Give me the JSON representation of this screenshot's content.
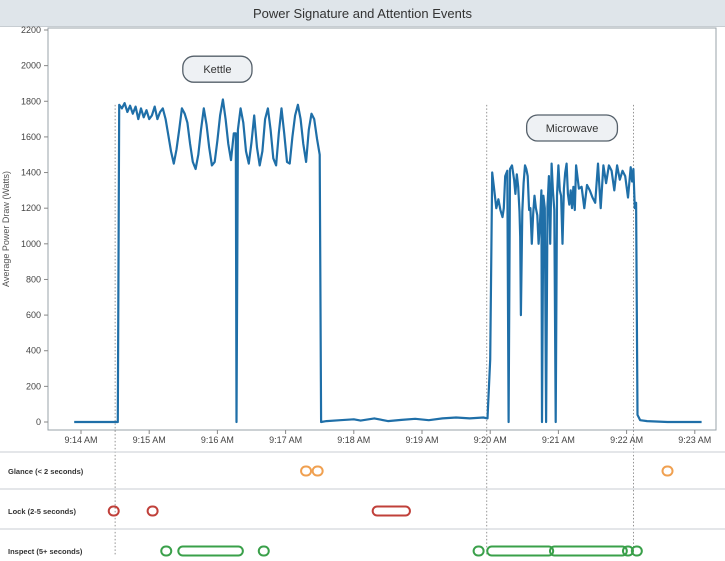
{
  "chart_data": {
    "type": "line",
    "title": "Power Signature and Attention Events",
    "ylabel": "Average Power Draw (Watts)",
    "xlabel": "",
    "ylim": [
      0,
      2200
    ],
    "y_ticks": [
      0,
      200,
      400,
      600,
      800,
      1000,
      1200,
      1400,
      1600,
      1800,
      2000,
      2200
    ],
    "x_ticks": [
      {
        "t": 0,
        "label": "9:14 AM"
      },
      {
        "t": 1,
        "label": "9:15 AM"
      },
      {
        "t": 2,
        "label": "9:16 AM"
      },
      {
        "t": 3,
        "label": "9:17 AM"
      },
      {
        "t": 4,
        "label": "9:18 AM"
      },
      {
        "t": 5,
        "label": "9:19 AM"
      },
      {
        "t": 6,
        "label": "9:20 AM"
      },
      {
        "t": 7,
        "label": "9:21 AM"
      },
      {
        "t": 8,
        "label": "9:22 AM"
      },
      {
        "t": 9,
        "label": "9:23 AM"
      }
    ],
    "x_unit": "minutes after 9:14 AM",
    "grid": false,
    "series": [
      {
        "name": "",
        "color": "#1f6fa8",
        "points": [
          [
            -0.1,
            0
          ],
          [
            0.5,
            0
          ],
          [
            0.54,
            0
          ],
          [
            0.56,
            1780
          ],
          [
            0.6,
            1760
          ],
          [
            0.64,
            1790
          ],
          [
            0.68,
            1740
          ],
          [
            0.72,
            1775
          ],
          [
            0.76,
            1730
          ],
          [
            0.8,
            1770
          ],
          [
            0.84,
            1700
          ],
          [
            0.88,
            1760
          ],
          [
            0.92,
            1710
          ],
          [
            0.96,
            1750
          ],
          [
            1.0,
            1700
          ],
          [
            1.04,
            1720
          ],
          [
            1.08,
            1770
          ],
          [
            1.12,
            1700
          ],
          [
            1.16,
            1740
          ],
          [
            1.2,
            1760
          ],
          [
            1.24,
            1700
          ],
          [
            1.28,
            1610
          ],
          [
            1.32,
            1520
          ],
          [
            1.36,
            1450
          ],
          [
            1.4,
            1530
          ],
          [
            1.44,
            1640
          ],
          [
            1.48,
            1760
          ],
          [
            1.52,
            1730
          ],
          [
            1.56,
            1680
          ],
          [
            1.6,
            1560
          ],
          [
            1.64,
            1460
          ],
          [
            1.68,
            1420
          ],
          [
            1.72,
            1500
          ],
          [
            1.76,
            1640
          ],
          [
            1.8,
            1760
          ],
          [
            1.84,
            1670
          ],
          [
            1.88,
            1540
          ],
          [
            1.92,
            1440
          ],
          [
            1.96,
            1460
          ],
          [
            2.0,
            1580
          ],
          [
            2.04,
            1720
          ],
          [
            2.08,
            1810
          ],
          [
            2.12,
            1700
          ],
          [
            2.16,
            1560
          ],
          [
            2.2,
            1470
          ],
          [
            2.24,
            1620
          ],
          [
            2.27,
            1620
          ],
          [
            2.28,
            0
          ],
          [
            2.3,
            1640
          ],
          [
            2.34,
            1760
          ],
          [
            2.38,
            1680
          ],
          [
            2.42,
            1520
          ],
          [
            2.46,
            1450
          ],
          [
            2.5,
            1570
          ],
          [
            2.54,
            1720
          ],
          [
            2.58,
            1540
          ],
          [
            2.62,
            1440
          ],
          [
            2.66,
            1520
          ],
          [
            2.7,
            1700
          ],
          [
            2.74,
            1760
          ],
          [
            2.78,
            1640
          ],
          [
            2.82,
            1480
          ],
          [
            2.86,
            1440
          ],
          [
            2.9,
            1620
          ],
          [
            2.94,
            1760
          ],
          [
            2.98,
            1620
          ],
          [
            3.02,
            1460
          ],
          [
            3.06,
            1450
          ],
          [
            3.1,
            1600
          ],
          [
            3.14,
            1720
          ],
          [
            3.18,
            1780
          ],
          [
            3.22,
            1700
          ],
          [
            3.26,
            1560
          ],
          [
            3.3,
            1460
          ],
          [
            3.34,
            1640
          ],
          [
            3.38,
            1730
          ],
          [
            3.42,
            1700
          ],
          [
            3.46,
            1590
          ],
          [
            3.5,
            1500
          ],
          [
            3.52,
            0
          ],
          [
            3.6,
            5
          ],
          [
            3.8,
            10
          ],
          [
            4.0,
            15
          ],
          [
            4.1,
            8
          ],
          [
            4.3,
            20
          ],
          [
            4.5,
            5
          ],
          [
            4.7,
            12
          ],
          [
            4.9,
            18
          ],
          [
            5.1,
            10
          ],
          [
            5.3,
            20
          ],
          [
            5.5,
            25
          ],
          [
            5.7,
            20
          ],
          [
            5.9,
            25
          ],
          [
            5.96,
            20
          ],
          [
            6.0,
            350
          ],
          [
            6.03,
            1400
          ],
          [
            6.06,
            1300
          ],
          [
            6.09,
            1200
          ],
          [
            6.12,
            1250
          ],
          [
            6.15,
            1190
          ],
          [
            6.18,
            1150
          ],
          [
            6.2,
            1200
          ],
          [
            6.22,
            1380
          ],
          [
            6.25,
            1410
          ],
          [
            6.27,
            0
          ],
          [
            6.29,
            1420
          ],
          [
            6.32,
            1440
          ],
          [
            6.35,
            1360
          ],
          [
            6.37,
            1280
          ],
          [
            6.39,
            1390
          ],
          [
            6.41,
            1320
          ],
          [
            6.43,
            1180
          ],
          [
            6.44,
            1040
          ],
          [
            6.45,
            600
          ],
          [
            6.47,
            1180
          ],
          [
            6.49,
            1340
          ],
          [
            6.51,
            1440
          ],
          [
            6.53,
            1420
          ],
          [
            6.55,
            1380
          ],
          [
            6.57,
            1190
          ],
          [
            6.59,
            1200
          ],
          [
            6.61,
            1000
          ],
          [
            6.63,
            1170
          ],
          [
            6.65,
            1270
          ],
          [
            6.67,
            1200
          ],
          [
            6.69,
            1160
          ],
          [
            6.71,
            1000
          ],
          [
            6.73,
            1120
          ],
          [
            6.75,
            1300
          ],
          [
            6.76,
            0
          ],
          [
            6.78,
            1270
          ],
          [
            6.8,
            1200
          ],
          [
            6.82,
            0
          ],
          [
            6.84,
            1210
          ],
          [
            6.86,
            1380
          ],
          [
            6.88,
            1000
          ],
          [
            6.9,
            1450
          ],
          [
            6.92,
            1300
          ],
          [
            6.94,
            1190
          ],
          [
            6.96,
            0
          ],
          [
            6.98,
            1270
          ],
          [
            7.0,
            1440
          ],
          [
            7.02,
            1300
          ],
          [
            7.04,
            1270
          ],
          [
            7.06,
            1000
          ],
          [
            7.08,
            1310
          ],
          [
            7.1,
            1400
          ],
          [
            7.12,
            1450
          ],
          [
            7.14,
            1280
          ],
          [
            7.16,
            1220
          ],
          [
            7.18,
            1300
          ],
          [
            7.2,
            1200
          ],
          [
            7.22,
            1320
          ],
          [
            7.24,
            1190
          ],
          [
            7.26,
            1440
          ],
          [
            7.3,
            1310
          ],
          [
            7.34,
            1320
          ],
          [
            7.38,
            1200
          ],
          [
            7.42,
            1330
          ],
          [
            7.46,
            1300
          ],
          [
            7.5,
            1260
          ],
          [
            7.54,
            1230
          ],
          [
            7.58,
            1450
          ],
          [
            7.62,
            1200
          ],
          [
            7.66,
            1440
          ],
          [
            7.7,
            1340
          ],
          [
            7.74,
            1440
          ],
          [
            7.78,
            1410
          ],
          [
            7.82,
            1300
          ],
          [
            7.86,
            1440
          ],
          [
            7.9,
            1360
          ],
          [
            7.94,
            1410
          ],
          [
            7.98,
            1380
          ],
          [
            8.02,
            1260
          ],
          [
            8.06,
            1430
          ],
          [
            8.08,
            1350
          ],
          [
            8.1,
            1420
          ],
          [
            8.12,
            1200
          ],
          [
            8.14,
            1230
          ],
          [
            8.16,
            40
          ],
          [
            8.2,
            10
          ],
          [
            8.3,
            5
          ],
          [
            8.6,
            0
          ],
          [
            9.0,
            0
          ],
          [
            9.1,
            0
          ]
        ]
      }
    ],
    "annotations": [
      {
        "text": "Kettle",
        "t": 2.0,
        "y": 1980
      },
      {
        "text": "Microwave",
        "t": 7.2,
        "y": 1650
      }
    ],
    "event_lanes": [
      {
        "label": "Glance (< 2 seconds)",
        "color": "#f0a050",
        "events": [
          {
            "start": 3.3,
            "end": 3.3
          },
          {
            "start": 3.47,
            "end": 3.47
          },
          {
            "start": 8.6,
            "end": 8.6
          }
        ]
      },
      {
        "label": "Lock (2-5 seconds)",
        "color": "#c0403a",
        "events": [
          {
            "start": 0.48,
            "end": 0.48
          },
          {
            "start": 1.05,
            "end": 1.05
          },
          {
            "start": 4.35,
            "end": 4.75
          }
        ]
      },
      {
        "label": "Inspect (5+ seconds)",
        "color": "#3aa04a",
        "events": [
          {
            "start": 1.25,
            "end": 1.25
          },
          {
            "start": 1.5,
            "end": 2.3
          },
          {
            "start": 2.68,
            "end": 2.68
          },
          {
            "start": 5.83,
            "end": 5.83
          },
          {
            "start": 6.03,
            "end": 6.85
          },
          {
            "start": 6.95,
            "end": 7.93
          },
          {
            "start": 8.02,
            "end": 8.02
          },
          {
            "start": 8.15,
            "end": 8.15
          }
        ]
      }
    ],
    "markers": [
      0.5,
      5.95,
      8.1
    ]
  }
}
